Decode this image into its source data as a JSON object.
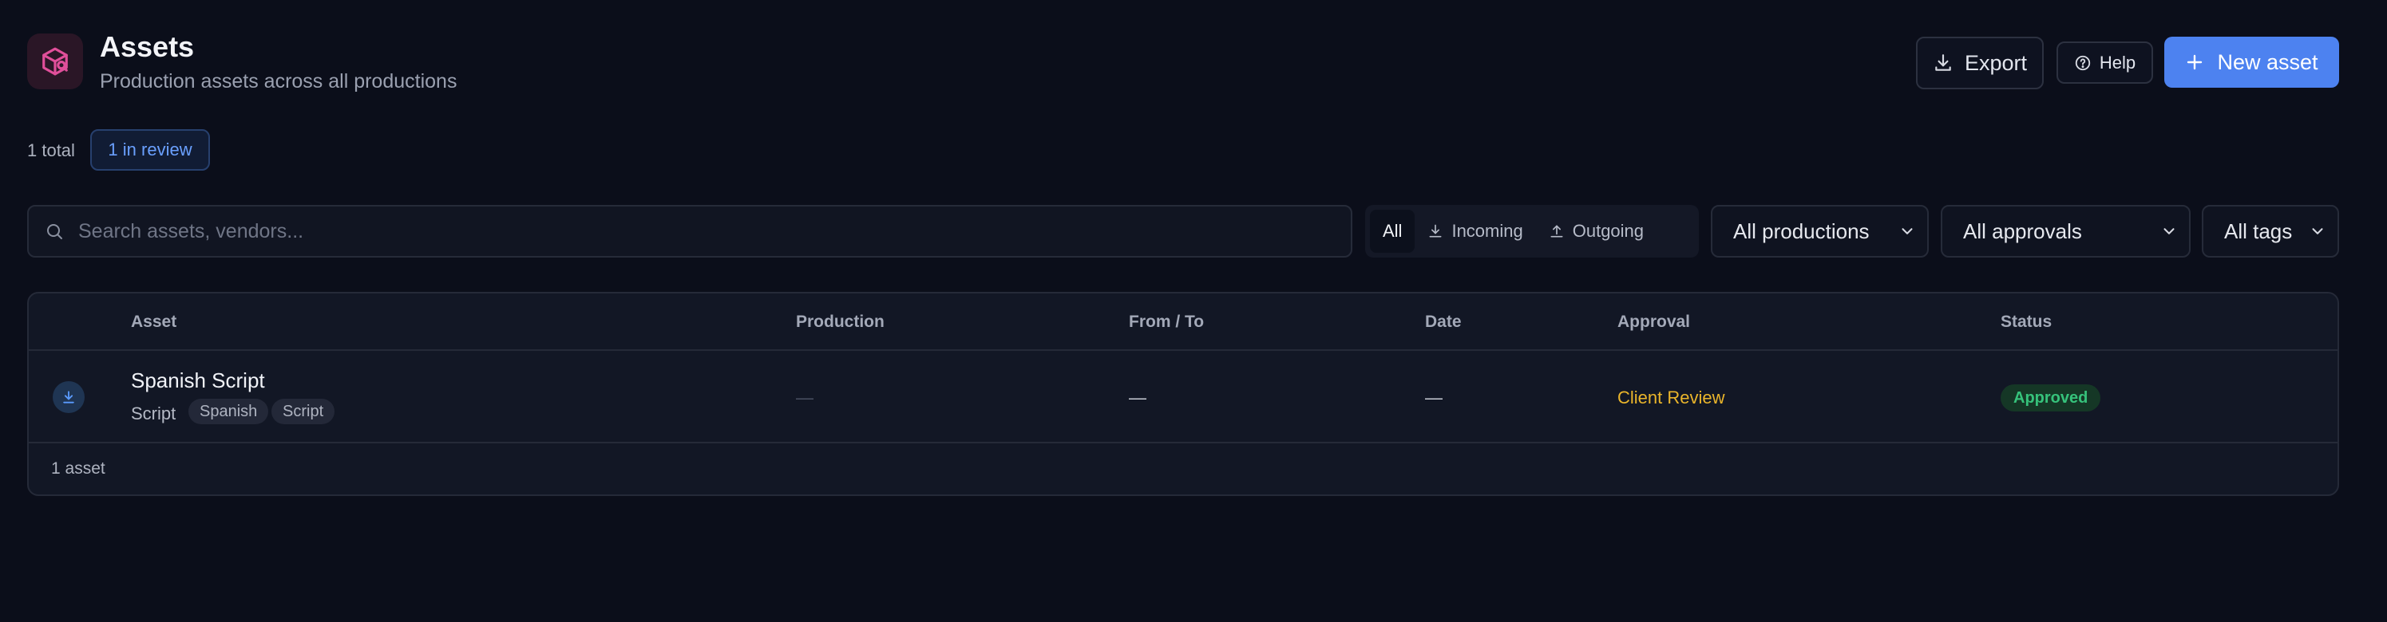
{
  "header": {
    "title": "Assets",
    "subtitle": "Production assets across all productions",
    "export_label": "Export",
    "help_label": "Help",
    "new_asset_label": "New asset"
  },
  "counts": {
    "total": "1 total",
    "in_review": "1 in review"
  },
  "filters": {
    "search_placeholder": "Search assets, vendors...",
    "direction_tabs": [
      "All",
      "Incoming",
      "Outgoing"
    ],
    "production": "All productions",
    "approval": "All approvals",
    "tags": "All tags"
  },
  "table": {
    "columns": [
      "Asset",
      "Production",
      "From / To",
      "Date",
      "Approval",
      "Status"
    ],
    "rows": [
      {
        "direction_icon": "download-icon",
        "name": "Spanish Script",
        "type": "Script",
        "tags": [
          "Spanish",
          "Script"
        ],
        "production": "—",
        "from_to": "—",
        "date": "—",
        "approval": "Client Review",
        "status": "Approved"
      }
    ],
    "footer": "1 asset"
  },
  "colors": {
    "accent": "#4d82f0",
    "approval": "#eab52b",
    "status_approved": "#36c27b",
    "background": "#0b0e1a"
  }
}
